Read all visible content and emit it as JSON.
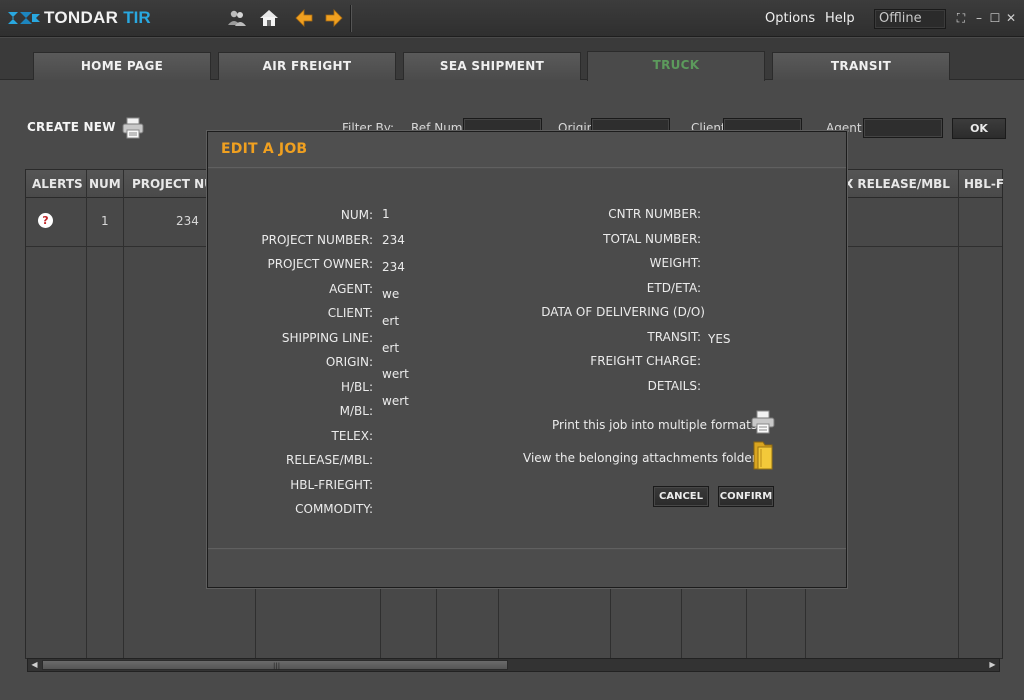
{
  "app": {
    "logo_main": "TONDAR",
    "logo_accent": "TIR"
  },
  "menu": {
    "options": "Options",
    "help": "Help"
  },
  "status": {
    "value": "Offline"
  },
  "icons": {
    "users": "users-icon",
    "home": "home-icon",
    "back": "arrow-left-icon",
    "forward": "arrow-right-icon",
    "print": "printer-icon",
    "folder": "folder-icon",
    "alert": "question-alert-icon"
  },
  "colors": {
    "accent": "#f0a020",
    "active_tab": "#5c9a5c",
    "logo_accent": "#29a8e0",
    "alert": "#c0282b"
  },
  "tabs": [
    {
      "label": "HOME PAGE"
    },
    {
      "label": "AIR FREIGHT"
    },
    {
      "label": "SEA SHIPMENT"
    },
    {
      "label": "TRUCK",
      "active": true
    },
    {
      "label": "TRANSIT"
    }
  ],
  "toolbar": {
    "create_new": "CREATE NEW",
    "filter_by": "Filter By:",
    "ref_num": "Ref Num",
    "origin": "Origin",
    "client": "Client",
    "agent": "Agent",
    "ok": "OK"
  },
  "grid": {
    "headers": {
      "alerts": "ALERTS",
      "num": "NUM",
      "project_number": "PROJECT NU",
      "telex_release": "X RELEASE/MBL",
      "hbl": "HBL-F"
    },
    "rows": [
      {
        "num": "1",
        "project_number": "234"
      }
    ]
  },
  "modal": {
    "title": "EDIT A JOB",
    "left_fields": [
      {
        "label": "NUM:",
        "value": "1"
      },
      {
        "label": "PROJECT NUMBER:",
        "value": "234"
      },
      {
        "label": "PROJECT OWNER:",
        "value": "234"
      },
      {
        "label": "AGENT:",
        "value": "we"
      },
      {
        "label": "CLIENT:",
        "value": "ert"
      },
      {
        "label": "SHIPPING LINE:",
        "value": "ert"
      },
      {
        "label": "ORIGIN:",
        "value": "wert"
      },
      {
        "label": "H/BL:",
        "value": "wert"
      },
      {
        "label": "M/BL:",
        "value": ""
      },
      {
        "label": "TELEX:",
        "value": ""
      },
      {
        "label": "RELEASE/MBL:",
        "value": ""
      },
      {
        "label": "HBL-FRIEGHT:",
        "value": ""
      },
      {
        "label": "COMMODITY:",
        "value": ""
      }
    ],
    "right_fields": [
      {
        "label": "CNTR NUMBER:",
        "value": ""
      },
      {
        "label": "TOTAL NUMBER:",
        "value": ""
      },
      {
        "label": "WEIGHT:",
        "value": ""
      },
      {
        "label": "ETD/ETA:",
        "value": ""
      },
      {
        "label": "DATA OF DELIVERING (D/O)",
        "value": ""
      },
      {
        "label": "TRANSIT:",
        "value": "YES"
      },
      {
        "label": "FREIGHT CHARGE:",
        "value": ""
      },
      {
        "label": "DETAILS:",
        "value": ""
      }
    ],
    "print_text": "Print this job into multiple formats",
    "attach_text": "View the belonging attachments folder",
    "cancel": "CANCEL",
    "confirm": "CONFIRM"
  }
}
